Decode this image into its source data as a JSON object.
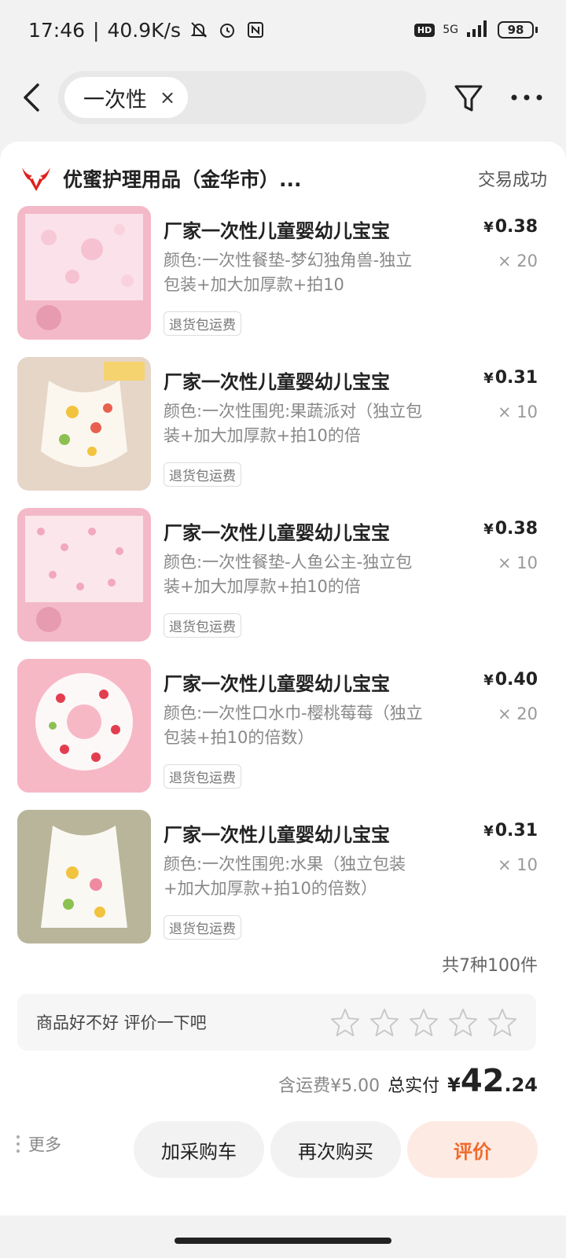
{
  "status_bar": {
    "time": "17:46",
    "net_speed": "40.9K/s",
    "network": "5G",
    "hd": "HD",
    "battery": "98"
  },
  "search": {
    "chip_text": "一次性",
    "chip_clear": "×"
  },
  "shop": {
    "name": "优蜜护理用品（金华市）...",
    "status": "交易成功"
  },
  "items": [
    {
      "title": "厂家一次性儿童婴幼儿宝宝",
      "spec": "颜色:一次性餐垫-梦幻独角兽-独立包装+加大加厚款+拍10",
      "tag": "退货包运费",
      "price_symbol": "¥",
      "price": "0.38",
      "qty": "× 20"
    },
    {
      "title": "厂家一次性儿童婴幼儿宝宝",
      "spec": "颜色:一次性围兜:果蔬派对（独立包装+加大加厚款+拍10的倍",
      "tag": "退货包运费",
      "price_symbol": "¥",
      "price": "0.31",
      "qty": "× 10"
    },
    {
      "title": "厂家一次性儿童婴幼儿宝宝",
      "spec": "颜色:一次性餐垫-人鱼公主-独立包装+加大加厚款+拍10的倍",
      "tag": "退货包运费",
      "price_symbol": "¥",
      "price": "0.38",
      "qty": "× 10"
    },
    {
      "title": "厂家一次性儿童婴幼儿宝宝",
      "spec": "颜色:一次性口水巾-樱桃莓莓（独立包装+拍10的倍数）",
      "tag": "退货包运费",
      "price_symbol": "¥",
      "price": "0.40",
      "qty": "× 20"
    },
    {
      "title": "厂家一次性儿童婴幼儿宝宝",
      "spec": "颜色:一次性围兜:水果（独立包装+加大加厚款+拍10的倍数）",
      "tag": "退货包运费",
      "price_symbol": "¥",
      "price": "0.31",
      "qty": "× 10"
    }
  ],
  "total_count": "共7种100件",
  "review": {
    "prompt": "商品好不好 评价一下吧",
    "rating": 0,
    "max": 5
  },
  "summary": {
    "shipping": "含运费¥5.00",
    "paid_label": "总实付",
    "currency": "¥",
    "amount_int": "42",
    "amount_dec": ".24"
  },
  "actions": {
    "more": "更多",
    "add_cart": "加采购车",
    "rebuy": "再次购买",
    "review": "评价"
  },
  "colors": {
    "accent": "#f06a2c",
    "accent_bg": "#fdebe3",
    "logo_red": "#e0201b"
  }
}
